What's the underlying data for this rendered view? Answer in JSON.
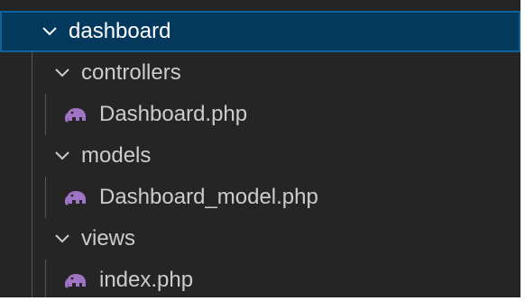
{
  "tree": {
    "root": {
      "label": "dashboard",
      "expanded": true,
      "selected": true
    },
    "folders": [
      {
        "label": "controllers",
        "expanded": true,
        "files": [
          {
            "label": "Dashboard.php",
            "icon": "php-elephant-icon"
          }
        ]
      },
      {
        "label": "models",
        "expanded": true,
        "files": [
          {
            "label": "Dashboard_model.php",
            "icon": "php-elephant-icon"
          }
        ]
      },
      {
        "label": "views",
        "expanded": true,
        "files": [
          {
            "label": "index.php",
            "icon": "php-elephant-icon"
          }
        ]
      }
    ]
  },
  "colors": {
    "background": "#252526",
    "selected_background": "#04395e",
    "selected_border": "#0e639c",
    "text": "#cccccc",
    "php_icon": "#a074c4",
    "indent_guide": "#585858"
  }
}
